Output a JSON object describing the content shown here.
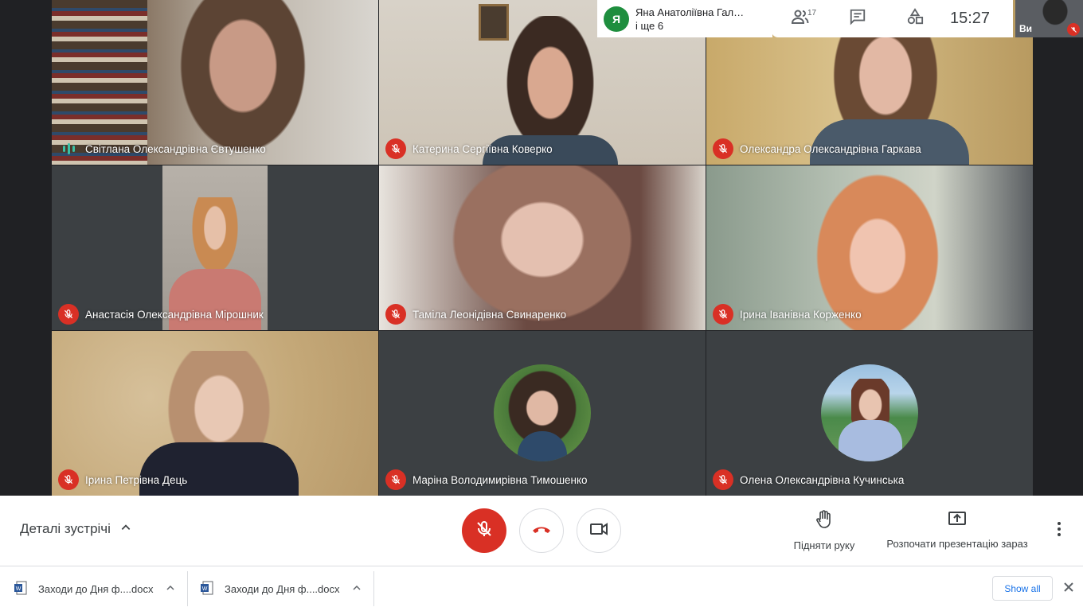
{
  "top": {
    "presenter_initial": "Я",
    "presenter_name": "Яна Анатоліївна Гал…",
    "presenter_more": "і ще 6",
    "participants_count": "17",
    "time": "15:27",
    "self_label": "Ви"
  },
  "tiles": [
    {
      "name": "Світлана Олександрівна Євтушенко",
      "speaking": true
    },
    {
      "name": "Катерина Сергіївна Коверко",
      "speaking": false
    },
    {
      "name": "Олександра Олександрівна Гаркава",
      "speaking": false
    },
    {
      "name": "Анастасія Олександрівна Мірошник",
      "speaking": false
    },
    {
      "name": "Таміла Леонідівна Свинаренко",
      "speaking": false
    },
    {
      "name": "Ірина Іванівна Корженко",
      "speaking": false
    },
    {
      "name": "Ірина Петрівна Дець",
      "speaking": false
    },
    {
      "name": "Маріна Володимирівна Тимошенко",
      "speaking": false
    },
    {
      "name": "Олена Олександрівна Кучинська",
      "speaking": false
    }
  ],
  "controls": {
    "meeting_details": "Деталі зустрічі",
    "raise_hand": "Підняти руку",
    "present_now": "Розпочати презентацію зараз"
  },
  "downloads": {
    "items": [
      {
        "filename": "Заходи до Дня ф....docx"
      },
      {
        "filename": "Заходи до Дня ф....docx"
      }
    ],
    "show_all": "Show all"
  },
  "colors": {
    "mute_red": "#d93025",
    "speaking_teal": "#39c1a6",
    "presenter_green": "#1e8e3e"
  }
}
